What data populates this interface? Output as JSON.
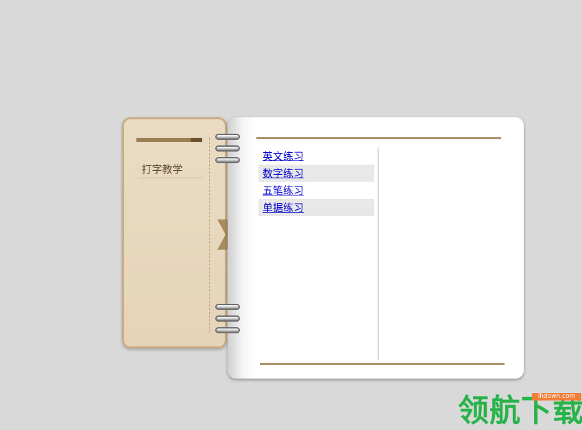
{
  "cover": {
    "title": "打字教学"
  },
  "menu": {
    "items": [
      {
        "label": "英文练习"
      },
      {
        "label": "数字练习"
      },
      {
        "label": "五笔练习"
      },
      {
        "label": "单据练习"
      }
    ]
  },
  "watermark": {
    "text": "领航下载",
    "badge": "lhdown.com"
  },
  "colors": {
    "background": "#d9d9d9",
    "cover": "#e7d7bd",
    "cover_border": "#c9ad85",
    "rule": "#a8926a",
    "link": "#0000cc",
    "watermark_green": "#29b34a",
    "watermark_badge": "#f07e3a"
  },
  "icons": {
    "cover_tab": "chevron-right-icon",
    "binder_rings": "ring-icon"
  }
}
